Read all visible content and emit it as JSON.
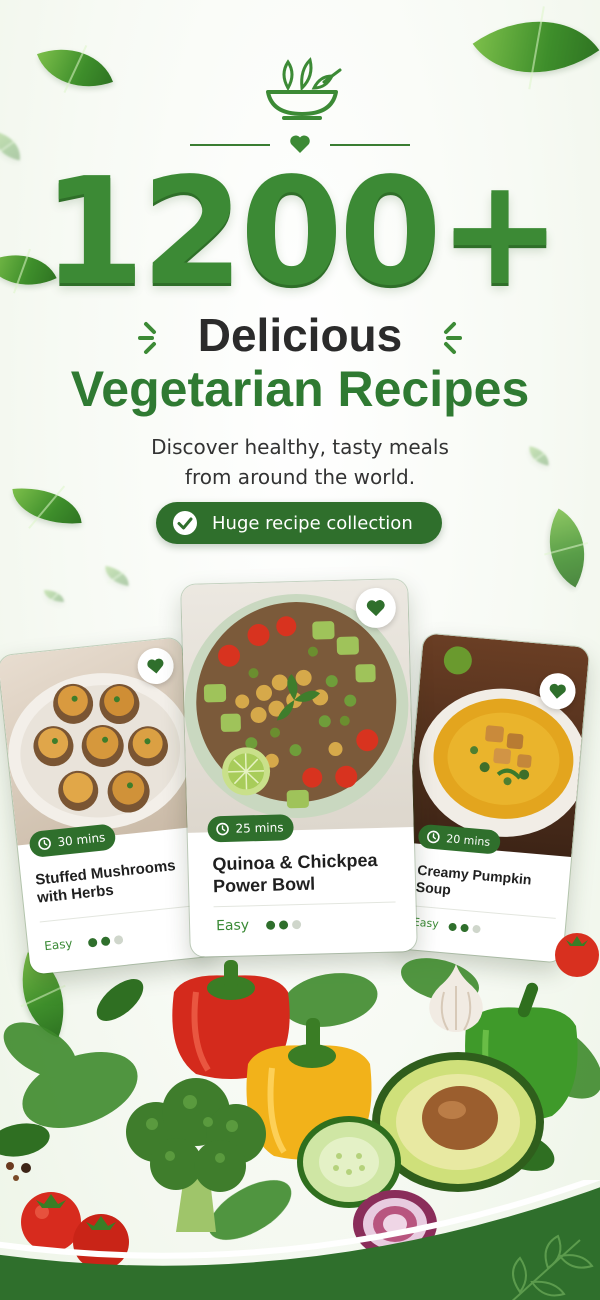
{
  "hero": {
    "count": "1200+",
    "line1": "Delicious",
    "line2": "Vegetarian Recipes",
    "tagline_1": "Discover healthy, tasty meals",
    "tagline_2": "from around the world.",
    "badge_label": "Huge recipe collection"
  },
  "cards": [
    {
      "title_1": "Stuffed Mushrooms",
      "title_2": "with Herbs",
      "time": "30 mins",
      "difficulty": "Easy",
      "level": 2,
      "level_max": 3,
      "icon": "heart-icon"
    },
    {
      "title_1": "Quinoa & Chickpea",
      "title_2": "Power Bowl",
      "time": "25 mins",
      "difficulty": "Easy",
      "level": 2,
      "level_max": 3,
      "icon": "heart-icon"
    },
    {
      "title_1": "Creamy Pumpkin",
      "title_2": "Soup",
      "time": "20 mins",
      "difficulty": "Easy",
      "level": 2,
      "level_max": 3,
      "icon": "heart-icon"
    }
  ],
  "colors": {
    "brand_green": "#3c8a35",
    "dark_green": "#2f6f2c",
    "text_dark": "#2b2b2b"
  },
  "icons": [
    "salad-bowl-logo-icon",
    "heart-icon",
    "check-icon",
    "clock-icon",
    "sparkle-icon",
    "leaf-icon"
  ]
}
